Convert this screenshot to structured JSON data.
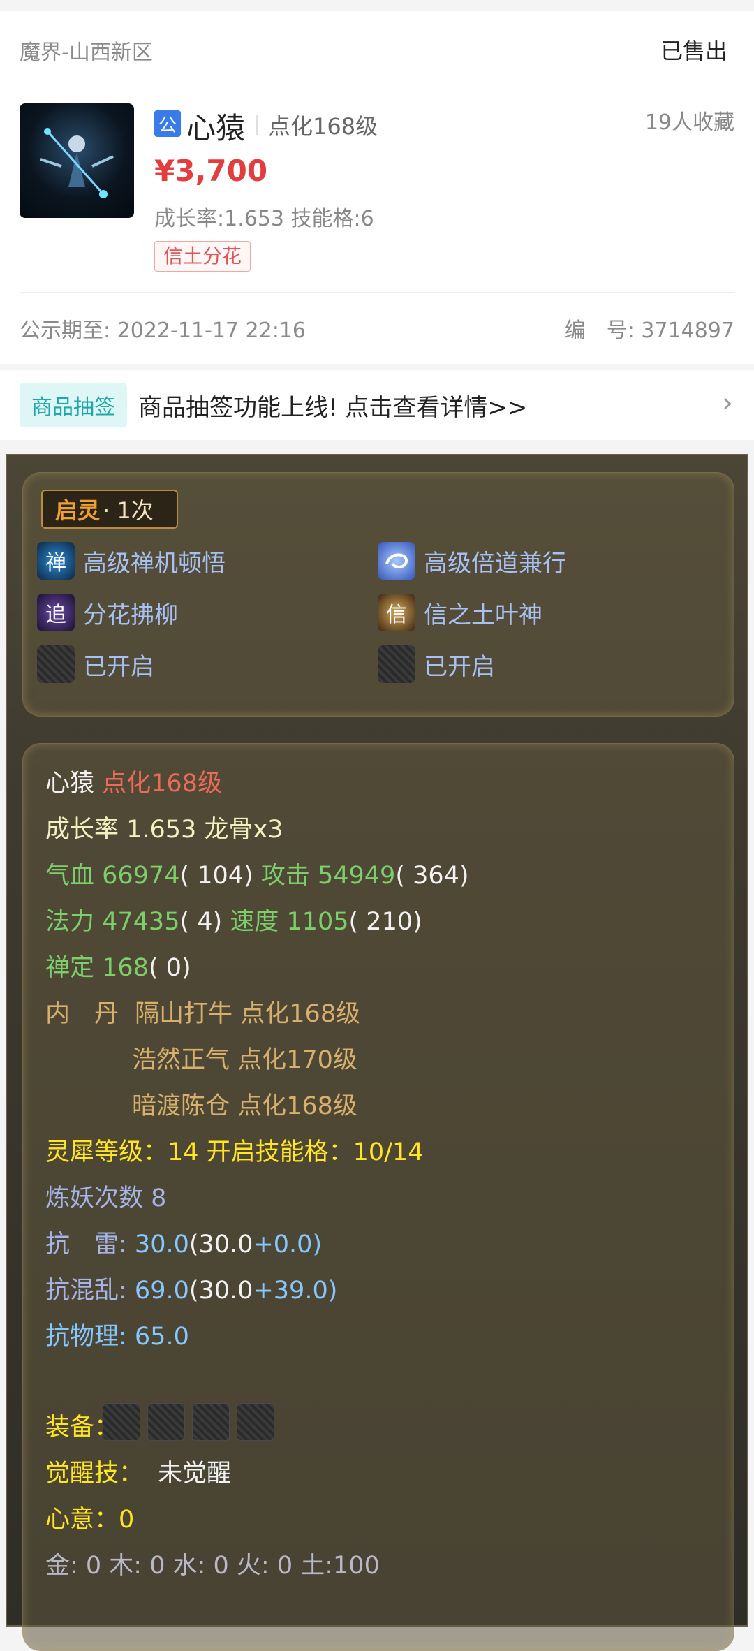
{
  "header": {
    "server": "魔界-山西新区",
    "status": "已售出"
  },
  "item": {
    "badge": "公",
    "name": "心猿",
    "level": "点化168级",
    "favorites": "19人收藏",
    "price": "¥3,700",
    "growth": "成长率:1.653 技能格:6",
    "tag": "信土分花",
    "notice": "公示期至: 2022-11-17 22:16",
    "serial": "编　号: 3714897"
  },
  "lottery": {
    "tag": "商品抽签",
    "text": "商品抽签功能上线! 点击查看详情>>",
    "arrow": "›"
  },
  "qiling": {
    "title": "启灵",
    "count": "· 1次",
    "skills": [
      {
        "label": "高级禅机顿悟",
        "icon": "zen-skill-icon",
        "glyph": "禅"
      },
      {
        "label": "高级倍道兼行",
        "icon": "swirl-skill-icon",
        "glyph": ""
      },
      {
        "label": "分花拂柳",
        "icon": "flower-skill-icon",
        "glyph": "追"
      },
      {
        "label": "信之土叶神",
        "icon": "faith-skill-icon",
        "glyph": "信"
      },
      {
        "label": "已开启",
        "icon": "locked-slot-icon",
        "glyph": ""
      },
      {
        "label": "已开启",
        "icon": "locked-slot-icon",
        "glyph": ""
      }
    ]
  },
  "stats": {
    "name": "心猿",
    "level": "点化168级",
    "growth_line": "成长率 1.653 龙骨x3",
    "hp_label": "气血 66974",
    "hp_extra": "( 104)",
    "atk_label": "攻击 54949",
    "atk_extra": "( 364)",
    "mp_label": "法力 47435",
    "mp_extra": "( 4)",
    "spd_label": "速度 1105",
    "spd_extra": "( 210)",
    "zen_label": "禅定 168",
    "zen_extra": "( 0)",
    "neidan_label": "内　丹",
    "neidan": [
      "隔山打牛 点化168级",
      "浩然正气 点化170级",
      "暗渡陈仓 点化168级"
    ],
    "lingxi": "灵犀等级：14 开启技能格：10/14",
    "lianyao": "炼妖次数 8",
    "res_thunder_label": "抗　雷: ",
    "res_thunder_val": "30.0",
    "res_thunder_base": "(30.0",
    "res_thunder_add": "+0.0)",
    "res_chaos_label": "抗混乱: ",
    "res_chaos_val": "69.0",
    "res_chaos_base": "(30.0",
    "res_chaos_add": "+39.0)",
    "res_phys": "抗物理: 65.0",
    "equip_label": "装备：",
    "awaken_label": "觉醒技：",
    "awaken_val": "未觉醒",
    "xinyi": "心意：0",
    "elements": "金: 0 木: 0 水: 0 火: 0 土:100"
  }
}
